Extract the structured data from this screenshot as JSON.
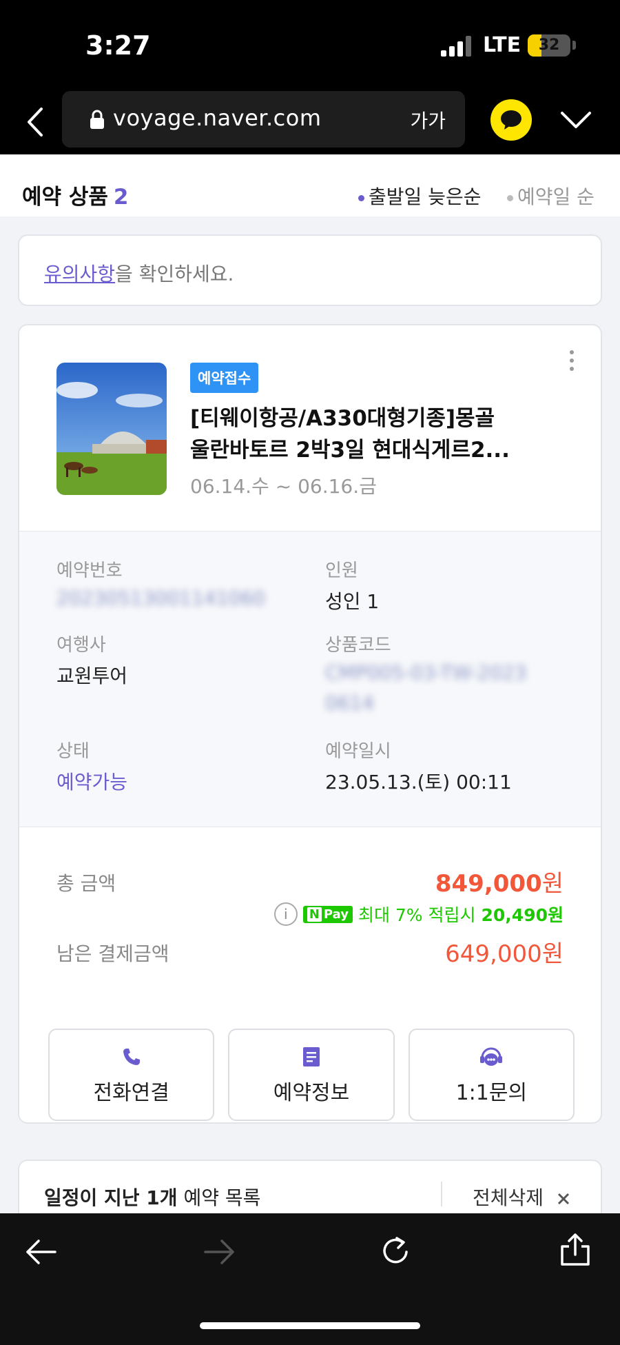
{
  "status_bar": {
    "time": "3:27",
    "network": "LTE",
    "battery": "32",
    "battery_level": 0.32
  },
  "browser": {
    "url": "voyage.naver.com",
    "text_size_label": "가가"
  },
  "header": {
    "title": "예약 상품",
    "count": "2",
    "sort_options": [
      "출발일 늦은순",
      "예약일 순"
    ],
    "active_sort": "출발일 늦은순"
  },
  "notice": {
    "link_text": "유의사항",
    "text": "을 확인하세요."
  },
  "reservation": {
    "status_badge": "예약접수",
    "title_line1": "[티웨이항공/A330대형기종]몽골",
    "title_line2": "울란바토르 2박3일 현대식게르2...",
    "dates": "06.14.수 ~ 06.16.금",
    "details": {
      "reservation_number_label": "예약번호",
      "reservation_number_value": "20230513001141060",
      "people_label": "인원",
      "people_value": "성인 1",
      "agency_label": "여행사",
      "agency_value": "교원투어",
      "product_code_label": "상품코드",
      "product_code_line1": "CMP005-03-TW-2023",
      "product_code_line2": "0614",
      "status_label": "상태",
      "status_value": "예약가능",
      "reserved_at_label": "예약일시",
      "reserved_at_value": "23.05.13.(토) 00:11"
    },
    "pricing": {
      "total_label": "총 금액",
      "total_amount": "849,000",
      "won": "원",
      "npay_text": "최대 7% 적립시",
      "npay_amount": "20,490원",
      "npay_logo": "Pay",
      "npay_n": "N",
      "remaining_label": "남은 결제금액",
      "remaining_amount": "649,000원"
    },
    "actions": {
      "call": "전화연결",
      "info": "예약정보",
      "inquiry": "1:1문의"
    }
  },
  "past": {
    "title_bold": "일정이 지난 1개",
    "title_rest": " 예약 목록",
    "delete_all": "전체삭제"
  },
  "colors": {
    "accent": "#6a5ccf",
    "price": "#f2573a",
    "npay": "#1ec800",
    "badge": "#2f93f5"
  }
}
